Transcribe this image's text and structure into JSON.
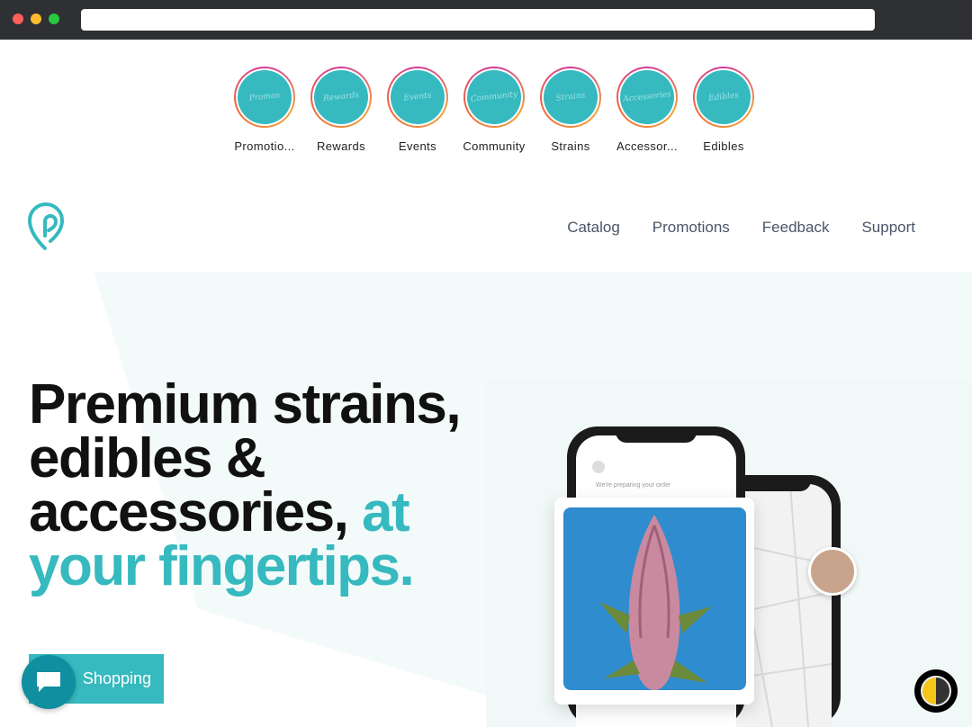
{
  "browser": {},
  "stories": [
    {
      "label": "Promotio...",
      "badge": "Promos"
    },
    {
      "label": "Rewards",
      "badge": "Rewards"
    },
    {
      "label": "Events",
      "badge": "Events"
    },
    {
      "label": "Community",
      "badge": "Community"
    },
    {
      "label": "Strains",
      "badge": "Strains"
    },
    {
      "label": "Accessor...",
      "badge": "Accessories"
    },
    {
      "label": "Edibles",
      "badge": "Edibles"
    }
  ],
  "nav": {
    "catalog": "Catalog",
    "promotions": "Promotions",
    "feedback": "Feedback",
    "support": "Support"
  },
  "hero": {
    "line1": "Premium strains,",
    "line2": "edibles &",
    "line3": "accessories,",
    "accent1": "at",
    "accent2": "your fingertips."
  },
  "cta_label": "Shopping",
  "phone": {
    "heading": "We're preparing your order"
  },
  "colors": {
    "accent": "#36b9bf",
    "chat": "#0f8fa0"
  },
  "icons": {
    "logo": "location-pin-logo",
    "chat": "chat-bubble-icon",
    "theme": "theme-toggle-icon"
  }
}
